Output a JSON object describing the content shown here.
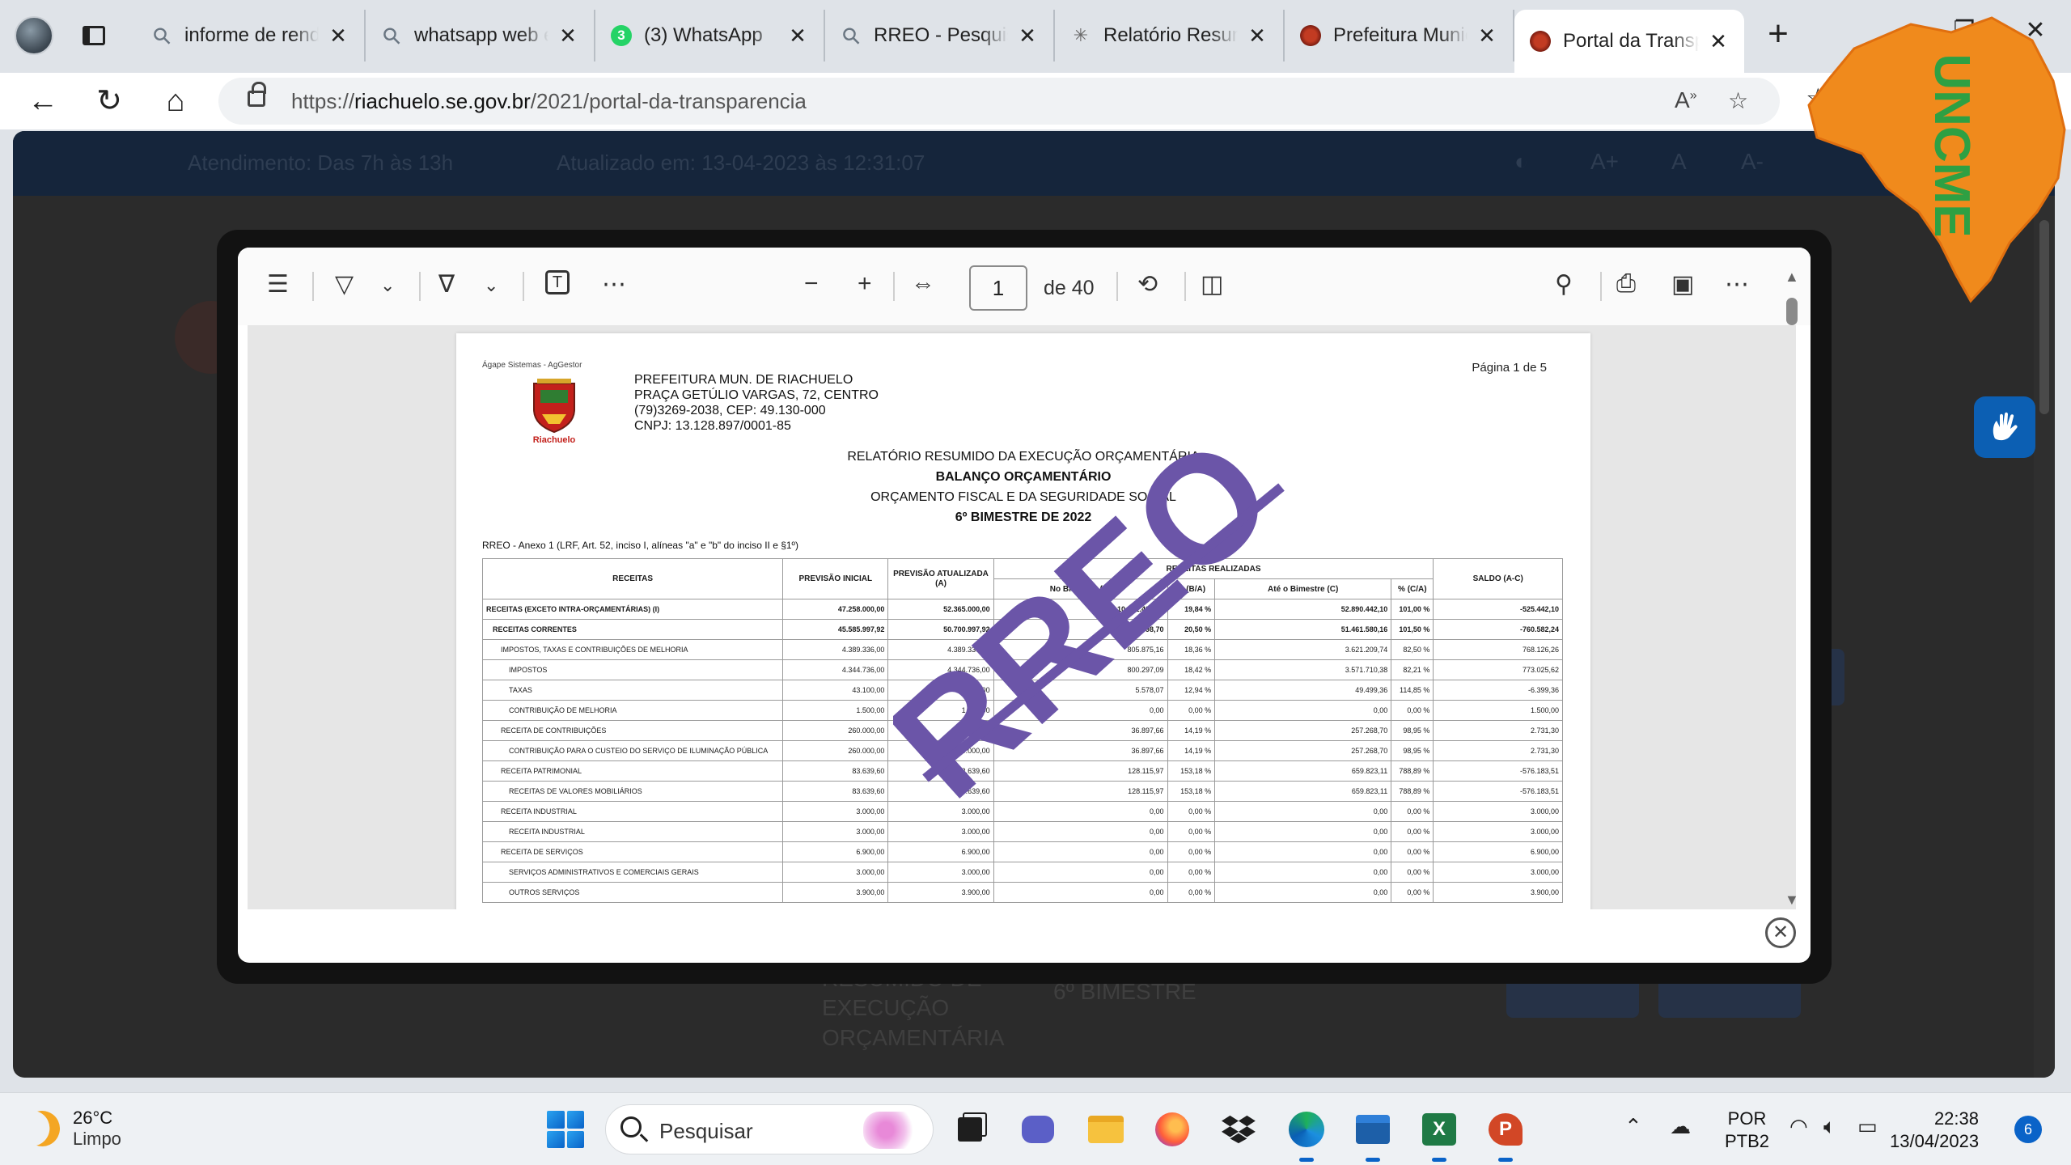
{
  "browser": {
    "tabs": [
      {
        "title": "informe de rendimentos",
        "icon": "search-icon",
        "active": false
      },
      {
        "title": "whatsapp web entrar",
        "icon": "search-icon",
        "active": false
      },
      {
        "title": "(3) WhatsApp",
        "icon": "whatsapp-icon",
        "badge": "3",
        "active": false
      },
      {
        "title": "RREO - Pesquisar",
        "icon": "search-icon",
        "active": false
      },
      {
        "title": "Relatório Resumido",
        "icon": "star-logo-icon",
        "active": false
      },
      {
        "title": "Prefeitura Municipal",
        "icon": "seal-icon",
        "active": false
      },
      {
        "title": "Portal da Transparência",
        "icon": "seal-icon",
        "active": true
      }
    ],
    "url_prefix": "https://",
    "url_domain": "riachuelo.se.gov.br",
    "url_path": "/2021/portal-da-transparencia"
  },
  "site": {
    "topbar_hours": "Atendimento: Das 7h às 13h",
    "topbar_updated": "Atualizado em: 13-04-2023 às 12:31:07",
    "bg_card_title": "RESUMIDO DE EXECUÇÃO ORÇAMENTÁRIA",
    "bg_card_period": "6º BIMESTRE",
    "logo_text": "UNCME",
    "logo_color": "#f08a1c",
    "logo_text_color": "#2ea043"
  },
  "pdf_viewer": {
    "current_page": "1",
    "page_count": "de 40"
  },
  "document": {
    "software": "Ágape Sistemas - AgGestor",
    "page_label": "Página 1 de 5",
    "coat_name": "Riachuelo",
    "org_lines": [
      "PREFEITURA MUN. DE RIACHUELO",
      "PRAÇA GETÚLIO VARGAS, 72, CENTRO",
      "(79)3269-2038, CEP: 49.130-000",
      "CNPJ: 13.128.897/0001-85"
    ],
    "title1": "RELATÓRIO RESUMIDO DA EXECUÇÃO ORÇAMENTÁRIA",
    "title2": "BALANÇO ORÇAMENTÁRIO",
    "title3": "ORÇAMENTO FISCAL E DA SEGURIDADE SOCIAL",
    "title4": "6º BIMESTRE DE 2022",
    "annex": "RREO - Anexo 1 (LRF, Art. 52, inciso I, alíneas \"a\" e \"b\" do inciso II e §1º)",
    "watermark": "RREO",
    "watermark_color": "#6b55a8",
    "headers": {
      "receitas": "RECEITAS",
      "previsao_inicial": "PREVISÃO INICIAL",
      "previsao_atualizada": "PREVISÃO ATUALIZADA (A)",
      "realizadas": "RECEITAS REALIZADAS",
      "no_bimestre": "No Bimestre (B)",
      "pct_ba": "% (B/A)",
      "ate_bimestre": "Até o Bimestre (C)",
      "pct_ca": "% (C/A)",
      "saldo": "SALDO (A-C)"
    },
    "rows": [
      {
        "name": "RECEITAS (EXCETO INTRA-ORÇAMENTÁRIAS) (I)",
        "ini": "47.258.000,00",
        "atu": "52.365.000,00",
        "bim": "10.391.498,70",
        "pba": "19,84 %",
        "ate": "52.890.442,10",
        "pca": "101,00 %",
        "saldo": "-525.442,10",
        "level": 0
      },
      {
        "name": "RECEITAS CORRENTES",
        "ini": "45.585.997,92",
        "atu": "50.700.997,92",
        "bim": "10.391.498,70",
        "pba": "20,50 %",
        "ate": "51.461.580,16",
        "pca": "101,50 %",
        "saldo": "-760.582,24",
        "level": 1
      },
      {
        "name": "IMPOSTOS, TAXAS E CONTRIBUIÇÕES DE MELHORIA",
        "ini": "4.389.336,00",
        "atu": "4.389.336,00",
        "bim": "805.875,16",
        "pba": "18,36 %",
        "ate": "3.621.209,74",
        "pca": "82,50 %",
        "saldo": "768.126,26",
        "level": 2
      },
      {
        "name": "IMPOSTOS",
        "ini": "4.344.736,00",
        "atu": "4.344.736,00",
        "bim": "800.297,09",
        "pba": "18,42 %",
        "ate": "3.571.710,38",
        "pca": "82,21 %",
        "saldo": "773.025,62",
        "level": 3
      },
      {
        "name": "TAXAS",
        "ini": "43.100,00",
        "atu": "43.100,00",
        "bim": "5.578,07",
        "pba": "12,94 %",
        "ate": "49.499,36",
        "pca": "114,85 %",
        "saldo": "-6.399,36",
        "level": 3
      },
      {
        "name": "CONTRIBUIÇÃO DE MELHORIA",
        "ini": "1.500,00",
        "atu": "1.500,00",
        "bim": "0,00",
        "pba": "0,00 %",
        "ate": "0,00",
        "pca": "0,00 %",
        "saldo": "1.500,00",
        "level": 3
      },
      {
        "name": "RECEITA DE CONTRIBUIÇÕES",
        "ini": "260.000,00",
        "atu": "260.000,00",
        "bim": "36.897,66",
        "pba": "14,19 %",
        "ate": "257.268,70",
        "pca": "98,95 %",
        "saldo": "2.731,30",
        "level": 2
      },
      {
        "name": "CONTRIBUIÇÃO PARA O CUSTEIO DO SERVIÇO DE ILUMINAÇÃO PÚBLICA",
        "ini": "260.000,00",
        "atu": "260.000,00",
        "bim": "36.897,66",
        "pba": "14,19 %",
        "ate": "257.268,70",
        "pca": "98,95 %",
        "saldo": "2.731,30",
        "level": 3
      },
      {
        "name": "RECEITA PATRIMONIAL",
        "ini": "83.639,60",
        "atu": "83.639,60",
        "bim": "128.115,97",
        "pba": "153,18 %",
        "ate": "659.823,11",
        "pca": "788,89 %",
        "saldo": "-576.183,51",
        "level": 2
      },
      {
        "name": "RECEITAS DE VALORES MOBILIÁRIOS",
        "ini": "83.639,60",
        "atu": "83.639,60",
        "bim": "128.115,97",
        "pba": "153,18 %",
        "ate": "659.823,11",
        "pca": "788,89 %",
        "saldo": "-576.183,51",
        "level": 3
      },
      {
        "name": "RECEITA INDUSTRIAL",
        "ini": "3.000,00",
        "atu": "3.000,00",
        "bim": "0,00",
        "pba": "0,00 %",
        "ate": "0,00",
        "pca": "0,00 %",
        "saldo": "3.000,00",
        "level": 2
      },
      {
        "name": "RECEITA INDUSTRIAL",
        "ini": "3.000,00",
        "atu": "3.000,00",
        "bim": "0,00",
        "pba": "0,00 %",
        "ate": "0,00",
        "pca": "0,00 %",
        "saldo": "3.000,00",
        "level": 3
      },
      {
        "name": "RECEITA DE SERVIÇOS",
        "ini": "6.900,00",
        "atu": "6.900,00",
        "bim": "0,00",
        "pba": "0,00 %",
        "ate": "0,00",
        "pca": "0,00 %",
        "saldo": "6.900,00",
        "level": 2
      },
      {
        "name": "SERVIÇOS ADMINISTRATIVOS E COMERCIAIS GERAIS",
        "ini": "3.000,00",
        "atu": "3.000,00",
        "bim": "0,00",
        "pba": "0,00 %",
        "ate": "0,00",
        "pca": "0,00 %",
        "saldo": "3.000,00",
        "level": 3
      },
      {
        "name": "OUTROS SERVIÇOS",
        "ini": "3.900,00",
        "atu": "3.900,00",
        "bim": "0,00",
        "pba": "0,00 %",
        "ate": "0,00",
        "pca": "0,00 %",
        "saldo": "3.900,00",
        "level": 3
      }
    ]
  },
  "taskbar": {
    "temperature": "26°C",
    "weather": "Limpo",
    "search_label": "Pesquisar",
    "lang1": "POR",
    "lang2": "PTB2",
    "time": "22:38",
    "date": "13/04/2023",
    "notifications": "6"
  }
}
